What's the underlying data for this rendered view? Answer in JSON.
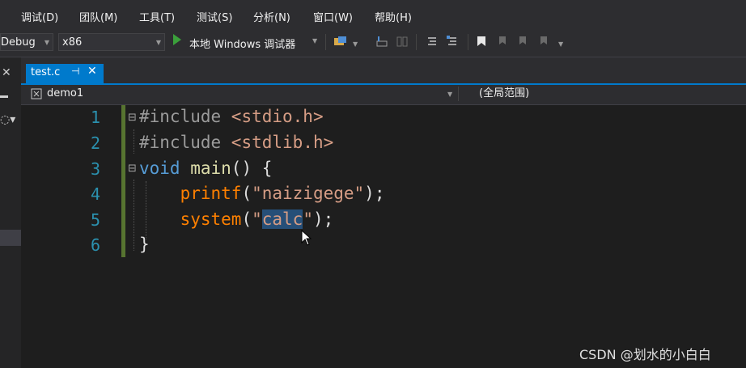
{
  "menu": [
    {
      "name": "menu-debug",
      "label": "调试(D)"
    },
    {
      "name": "menu-team",
      "label": "团队(M)"
    },
    {
      "name": "menu-tools",
      "label": "工具(T)"
    },
    {
      "name": "menu-test",
      "label": "测试(S)"
    },
    {
      "name": "menu-analyze",
      "label": "分析(N)"
    },
    {
      "name": "menu-window",
      "label": "窗口(W)"
    },
    {
      "name": "menu-help",
      "label": "帮助(H)"
    }
  ],
  "toolbar": {
    "config": "Debug",
    "platform": "x86",
    "run_label": "本地 Windows 调试器"
  },
  "tab": {
    "file": "test.c",
    "pin": "⊣",
    "close": "✕"
  },
  "navbar": {
    "project": "demo1",
    "scope": "(全局范围)"
  },
  "editor": {
    "line_numbers": [
      "1",
      "2",
      "3",
      "4",
      "5",
      "6"
    ],
    "lines": [
      {
        "tokens": [
          {
            "t": "#include ",
            "c": "tok-pre"
          },
          {
            "t": "<stdio.h>",
            "c": "tok-inc"
          }
        ]
      },
      {
        "tokens": [
          {
            "t": "#include ",
            "c": "tok-pre"
          },
          {
            "t": "<stdlib.h>",
            "c": "tok-inc"
          }
        ]
      },
      {
        "tokens": [
          {
            "t": "void ",
            "c": "tok-kw"
          },
          {
            "t": "main",
            "c": "tok-fn"
          },
          {
            "t": "() {",
            "c": "tok-punc"
          }
        ]
      },
      {
        "tokens": [
          {
            "t": "    ",
            "c": "tok-punc"
          },
          {
            "t": "printf",
            "c": "tok-fn2"
          },
          {
            "t": "(",
            "c": "tok-punc"
          },
          {
            "t": "\"naizigege\"",
            "c": "tok-str"
          },
          {
            "t": ");",
            "c": "tok-punc"
          }
        ]
      },
      {
        "tokens": [
          {
            "t": "    ",
            "c": "tok-punc"
          },
          {
            "t": "system",
            "c": "tok-fn2"
          },
          {
            "t": "(",
            "c": "tok-punc"
          },
          {
            "t": "\"",
            "c": "tok-str"
          },
          {
            "t": "calc",
            "c": "sel"
          },
          {
            "t": "\"",
            "c": "tok-str"
          },
          {
            "t": ");",
            "c": "tok-punc"
          }
        ]
      },
      {
        "tokens": [
          {
            "t": "}",
            "c": "tok-punc"
          }
        ]
      }
    ]
  },
  "watermark": "CSDN @划水的小白白",
  "colors": {
    "accent": "#007acc",
    "line_number": "#2b91af",
    "keyword": "#569cd6",
    "string": "#d69d85",
    "run_green": "#3ba03b"
  }
}
